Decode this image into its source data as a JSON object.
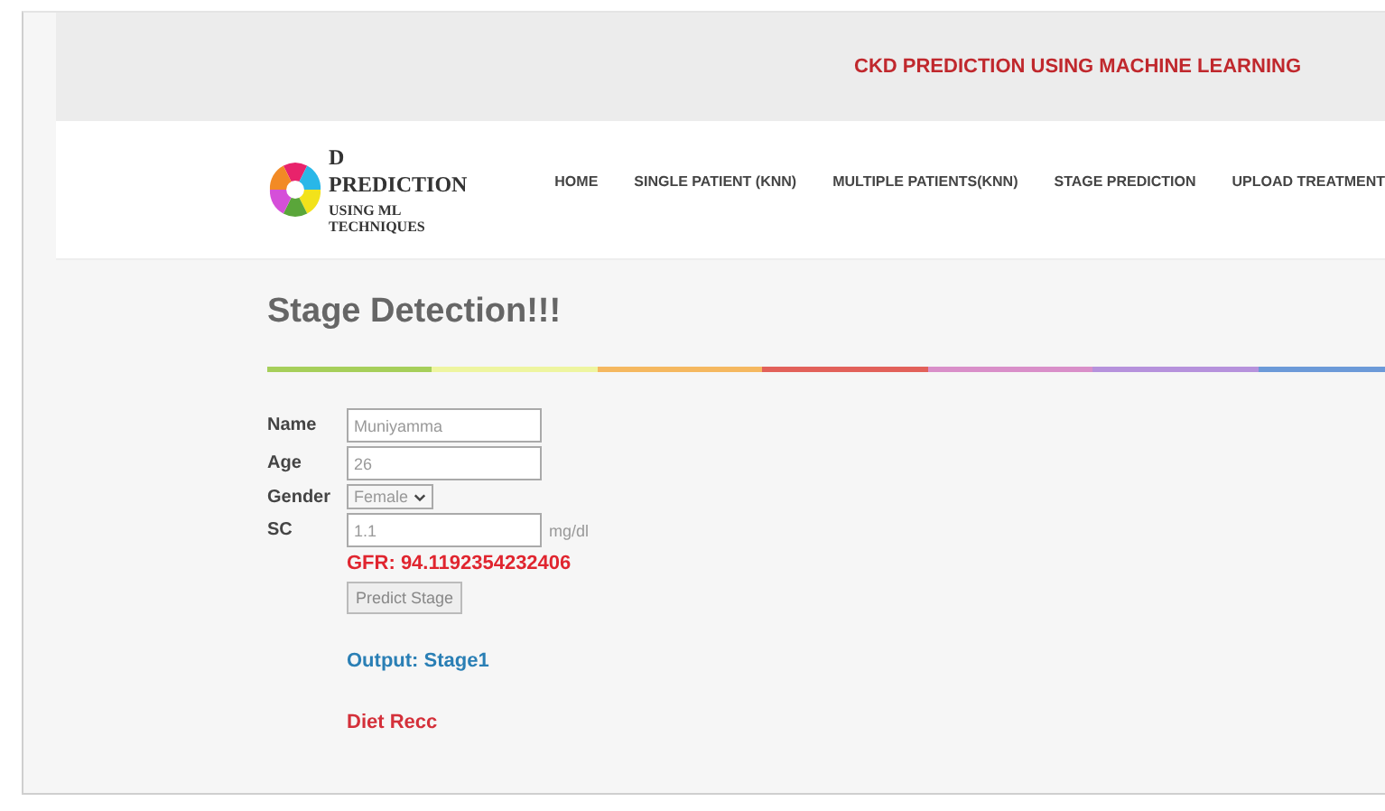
{
  "top_banner": {
    "title": "CKD PREDICTION USING MACHINE LEARNING"
  },
  "logo": {
    "line_1": "D PREDICTION",
    "line_2": "USING ML TECHNIQUES"
  },
  "nav": [
    {
      "label": "HOME"
    },
    {
      "label": "SINGLE PATIENT (KNN)"
    },
    {
      "label": "MULTIPLE PATIENTS(KNN)"
    },
    {
      "label": "STAGE PREDICTION"
    },
    {
      "label": "UPLOAD TREATMENT"
    }
  ],
  "heading": "Stage Detection!!!",
  "form": {
    "fields": [
      {
        "kind": "text",
        "label": "Name",
        "value": "Muniyamma"
      },
      {
        "kind": "text",
        "label": "Age",
        "value": "26"
      },
      {
        "kind": "select",
        "label": "Gender",
        "value": "Female"
      },
      {
        "kind": "text",
        "label": "SC",
        "value": "1.1",
        "unit": "mg/dl"
      }
    ],
    "gfr": "GFR: 94.1192354232406",
    "button": "Predict Stage"
  },
  "output": "Output: Stage1",
  "diet": "Diet Recc"
}
